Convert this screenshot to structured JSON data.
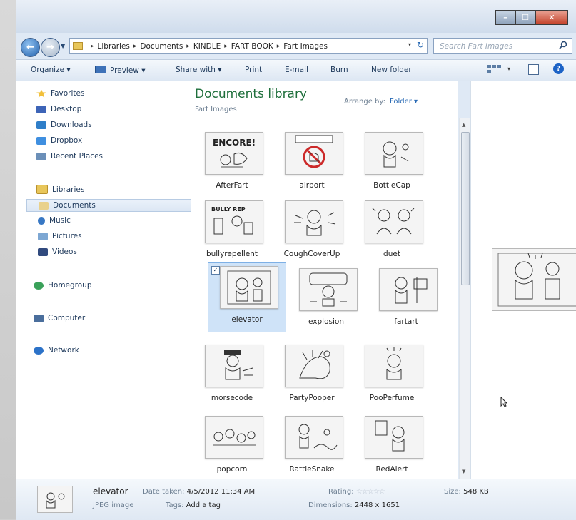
{
  "window": {
    "min": "–",
    "max": "☐",
    "close": "✕"
  },
  "nav": {
    "back": "←",
    "forward": "→",
    "drop": "▼"
  },
  "address": {
    "crumbs": [
      "Libraries",
      "Documents",
      "KINDLE",
      "FART BOOK",
      "Fart Images"
    ],
    "separator": "▸",
    "drop": "▾",
    "refresh": "↻"
  },
  "search": {
    "placeholder": "Search Fart Images",
    "icon": "magnifier-icon"
  },
  "toolbar": {
    "organize": "Organize ▾",
    "preview": "Preview ▾",
    "share": "Share with ▾",
    "print": "Print",
    "email": "E-mail",
    "burn": "Burn",
    "new_folder": "New folder",
    "views_drop": "▾",
    "help": "?"
  },
  "sidebar": {
    "favorites": "Favorites",
    "desktop": "Desktop",
    "downloads": "Downloads",
    "dropbox": "Dropbox",
    "recent": "Recent Places",
    "libraries": "Libraries",
    "documents": "Documents",
    "music": "Music",
    "pictures": "Pictures",
    "videos": "Videos",
    "homegroup": "Homegroup",
    "computer": "Computer",
    "network": "Network"
  },
  "content": {
    "title": "Documents library",
    "subtitle": "Fart Images",
    "arrange_label": "Arrange by:",
    "arrange_value": "Folder ▾",
    "files": [
      "AfterFart",
      "airport",
      "BottleCap",
      "bullyrepellent",
      "CoughCoverUp",
      "duet",
      "elevator",
      "explosion",
      "fartart",
      "morsecode",
      "PartyPooper",
      "PooPerfume",
      "popcorn",
      "RattleSnake",
      "RedAlert"
    ],
    "selected_check": "✓"
  },
  "scrollbar": {
    "up": "▲",
    "down": "▼"
  },
  "details": {
    "name": "elevator",
    "type": "JPEG image",
    "date_label": "Date taken:",
    "date_value": "4/5/2012 11:34 AM",
    "tags_label": "Tags:",
    "tags_value": "Add a tag",
    "rating_label": "Rating:",
    "rating_stars": "☆☆☆☆☆",
    "dims_label": "Dimensions:",
    "dims_value": "2448 x 1651",
    "size_label": "Size:",
    "size_value": "548 KB"
  }
}
